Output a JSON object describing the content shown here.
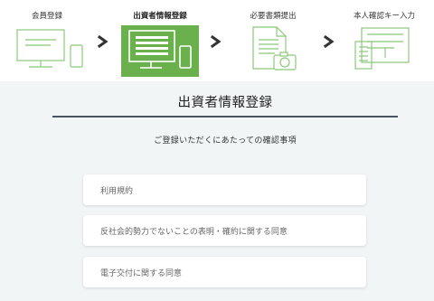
{
  "stepper": {
    "steps": [
      {
        "label": "会員登録",
        "icon": "computer-phone-icon"
      },
      {
        "label": "出資者情報登録",
        "icon": "form-screen-icon",
        "active": true
      },
      {
        "label": "必要書類提出",
        "icon": "document-camera-icon"
      },
      {
        "label": "本人確認キー入力",
        "icon": "mail-key-icon"
      }
    ],
    "colors": {
      "inactive_icon": "#8bc87a",
      "active_bg": "#6ab04c",
      "arrow": "#333333"
    }
  },
  "main": {
    "title": "出資者情報登録",
    "subtitle": "ご登録いただくにあたっての確認事項",
    "items": [
      {
        "label": "利用規約"
      },
      {
        "label": "反社会的勢力でないことの表明・確約に関する同意"
      },
      {
        "label": "電子交付に関する同意"
      }
    ]
  }
}
